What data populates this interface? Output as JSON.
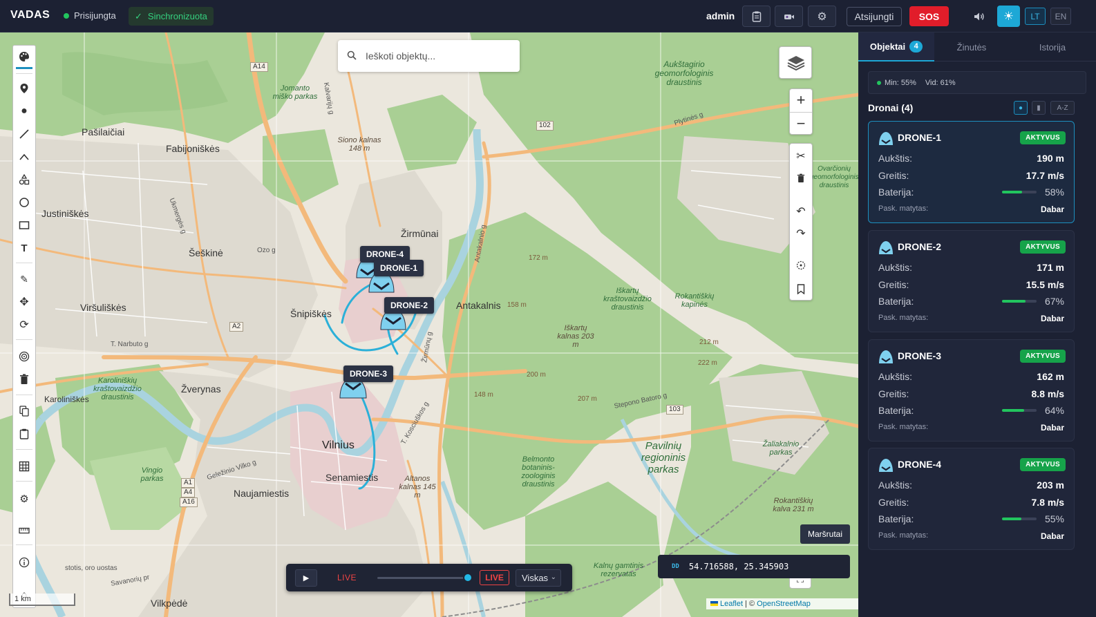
{
  "topbar": {
    "brand": "VADAS",
    "connection": "Prisijungta",
    "sync": "Sinchronizuota",
    "user": "admin",
    "logout": "Atsijungti",
    "sos": "SOS",
    "lang_lt": "LT",
    "lang_en": "EN"
  },
  "search": {
    "placeholder": "Ieškoti objektų..."
  },
  "map_labels": {
    "A14": "A14",
    "A2": "A2",
    "r102": "102",
    "r103": "103",
    "A1": "A1",
    "A4": "A4",
    "A16": "A16",
    "pasilaiciai": "Pašilaičiai",
    "fabijoniskes": "Fabijoniškės",
    "justiniskes": "Justiniškės",
    "seskine": "Šeškinė",
    "virsuliskes": "Viršuliškės",
    "zirmunai": "Žirmūnai",
    "snipiskes": "Šnipiškės",
    "antakalnis": "Antakalnis",
    "zverynas": "Žverynas",
    "vilnius": "Vilnius",
    "senamiestis": "Senamiestis",
    "naujamiestis": "Naujamiestis",
    "vilkpede": "Vilkpėdė",
    "ziniskes": "Karoliniškės",
    "karoliniskiu": "Karoliniškių kraštovaizdžio draustinis",
    "vingio": "Vingio parkas",
    "pavilniu": "Pavilnių regioninis parkas",
    "aukstagirio": "Aukštagirio geomorfologinis draustinis",
    "iskartu_dr": "Iškartų kraštovaizdžio draustinis",
    "iskartu_k": "Iškartų kalnas 203 m",
    "rokantiskiu_k": "Rokantiškių kapinės",
    "belmonto": "Belmonto botaninis-zoologinis draustinis",
    "altanos": "Altanos kalnas 145 m",
    "zaliakalnio": "Žaliakalnio parkas",
    "rokantiskiu_kalva": "Rokantiškių kalva 231 m",
    "ovarcioniu": "Ovarčionių geomorfologinis draustinis",
    "siono": "Siono kalnas 148 m",
    "jomanto": "Jomanto miško parkas",
    "kalnu_gamtinis": "Kalnų gamtinis rezervatas",
    "e172": "172 m",
    "e158": "158 m",
    "e200": "200 m",
    "e148": "148 m",
    "e207": "207 m",
    "e212": "212 m",
    "e222": "222 m",
    "plytines": "Plytinės g",
    "ozo": "Ozo g",
    "stepono": "Stepono Batoro g",
    "narbuto": "T. Narbuto g",
    "gelezinio": "Geležinio Vilko g",
    "savanoriu": "Savanorių pr",
    "kosciuskos": "T. Kosciuškos g",
    "antakalnio": "Antakalnio g",
    "zirmunu": "Žirmūnų g",
    "kalvariju": "Kalvarijų g",
    "ukmerges": "Ukmergės g",
    "stotis": "stotis, oro uostas"
  },
  "drones_on_map": [
    {
      "label": "DRONE-4"
    },
    {
      "label": "DRONE-1"
    },
    {
      "label": "DRONE-2"
    },
    {
      "label": "DRONE-3"
    }
  ],
  "playback": {
    "play": "▶",
    "live_text": "LIVE",
    "live_button": "LIVE",
    "filter": "Viskas",
    "progress": 0.95
  },
  "coords": {
    "format": "DD",
    "value": "54.716588, 25.345903"
  },
  "routes_tooltip": "Maršrutai",
  "attribution": {
    "leaflet": "Leaflet",
    "sep": " | © ",
    "osm": "OpenStreetMap"
  },
  "scale": "1 km",
  "panel": {
    "tabs": [
      {
        "label": "Objektai",
        "badge": "4"
      },
      {
        "label": "Žinutės"
      },
      {
        "label": "Istorija"
      }
    ],
    "stats": {
      "min": "Min: 55%",
      "avg": "Vid: 61%"
    },
    "section_title": "Dronai (4)",
    "sort": [
      "●",
      "▮",
      "A-Z"
    ],
    "labels": {
      "altitude": "Aukštis:",
      "speed": "Greitis:",
      "battery": "Baterija:",
      "last_seen": "Pask. matytas:"
    },
    "drones": [
      {
        "name": "DRONE-1",
        "status": "AKTYVUS",
        "altitude": "190 m",
        "speed": "17.7 m/s",
        "battery": "58%",
        "battery_level": 0.58,
        "last_seen": "Dabar"
      },
      {
        "name": "DRONE-2",
        "status": "AKTYVUS",
        "altitude": "171 m",
        "speed": "15.5 m/s",
        "battery": "67%",
        "battery_level": 0.67,
        "last_seen": "Dabar"
      },
      {
        "name": "DRONE-3",
        "status": "AKTYVUS",
        "altitude": "162 m",
        "speed": "8.8 m/s",
        "battery": "64%",
        "battery_level": 0.64,
        "last_seen": "Dabar"
      },
      {
        "name": "DRONE-4",
        "status": "AKTYVUS",
        "altitude": "203 m",
        "speed": "7.8 m/s",
        "battery": "55%",
        "battery_level": 0.55,
        "last_seen": "Dabar"
      }
    ]
  },
  "colors": {
    "accent": "#1da8d6",
    "active": "#16a34a",
    "sos": "#e11d2a",
    "track": "#2bb0d8"
  }
}
